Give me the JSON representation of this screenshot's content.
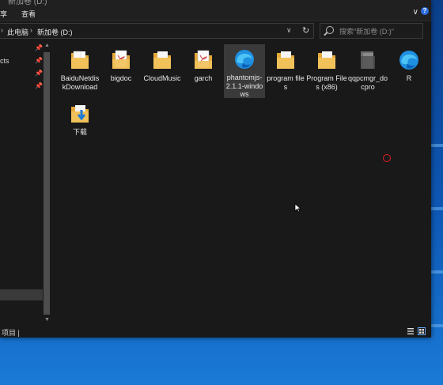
{
  "window": {
    "title": "新加卷 (D:)",
    "minimize": "—",
    "ribbon_tabs": [
      "享",
      "查看"
    ]
  },
  "address": {
    "crumbs": [
      "此电脑",
      "新加卷 (D:)"
    ],
    "refresh_icon": "refresh-icon"
  },
  "search": {
    "placeholder": "搜索\"新加卷 (D:)\""
  },
  "nav": {
    "items": [
      "cts",
      "",
      "",
      ""
    ],
    "pins": [
      "pin-icon",
      "pin-icon",
      "pin-icon",
      "pin-icon"
    ]
  },
  "files": [
    {
      "label": "BaiduNetdiskDownload",
      "icon": "folder-icon",
      "selected": false
    },
    {
      "label": "bigdoc",
      "icon": "pdf-folder-icon",
      "selected": false
    },
    {
      "label": "CloudMusic",
      "icon": "folder-icon",
      "selected": false
    },
    {
      "label": "garch",
      "icon": "pdf-folder-icon",
      "selected": false
    },
    {
      "label": "phantomjs-2.1.1-windows",
      "icon": "edge-icon",
      "selected": true
    },
    {
      "label": "program files",
      "icon": "folder-icon",
      "selected": false
    },
    {
      "label": "Program Files (x86)",
      "icon": "folder-icon",
      "selected": false
    },
    {
      "label": "qqpcmgr_docpro",
      "icon": "dark-folder-icon",
      "selected": false
    },
    {
      "label": "R",
      "icon": "edge-icon",
      "selected": false
    },
    {
      "label": "下载",
      "icon": "download-folder-icon",
      "selected": false
    }
  ],
  "status": {
    "text": "项目 |"
  },
  "colors": {
    "window_bg": "#191919",
    "accent": "#2d6cdf",
    "folder": "#f2c25a"
  }
}
